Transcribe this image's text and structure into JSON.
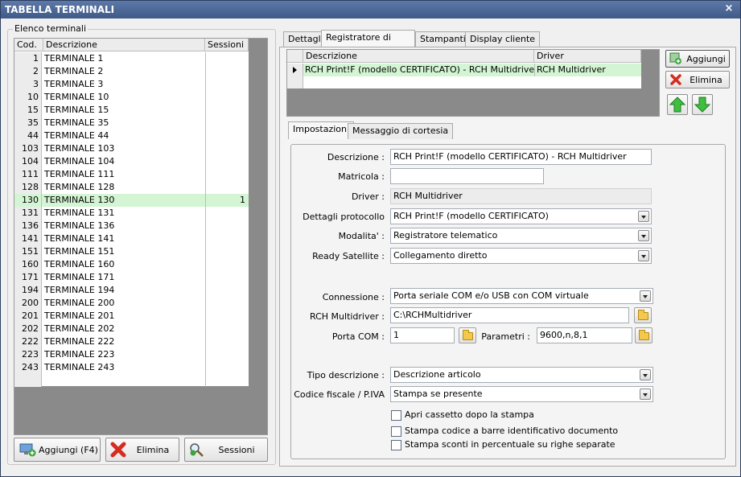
{
  "window": {
    "title": "TABELLA TERMINALI",
    "close": "×"
  },
  "left": {
    "group_title": "Elenco terminali",
    "columns": {
      "cod": "Cod.",
      "desc": "Descrizione",
      "sessions": "Sessioni"
    },
    "rows": [
      {
        "cod": "1",
        "desc": "TERMINALE 1",
        "sess": ""
      },
      {
        "cod": "2",
        "desc": "TERMINALE 2",
        "sess": ""
      },
      {
        "cod": "3",
        "desc": "TERMINALE 3",
        "sess": ""
      },
      {
        "cod": "10",
        "desc": "TERMINALE 10",
        "sess": ""
      },
      {
        "cod": "15",
        "desc": "TERMINALE 15",
        "sess": ""
      },
      {
        "cod": "35",
        "desc": "TERMINALE 35",
        "sess": ""
      },
      {
        "cod": "44",
        "desc": "TERMINALE 44",
        "sess": ""
      },
      {
        "cod": "103",
        "desc": "TERMINALE 103",
        "sess": ""
      },
      {
        "cod": "104",
        "desc": "TERMINALE 104",
        "sess": ""
      },
      {
        "cod": "111",
        "desc": "TERMINALE 111",
        "sess": ""
      },
      {
        "cod": "128",
        "desc": "TERMINALE 128",
        "sess": ""
      },
      {
        "cod": "130",
        "desc": "TERMINALE 130",
        "sess": "1"
      },
      {
        "cod": "131",
        "desc": "TERMINALE 131",
        "sess": ""
      },
      {
        "cod": "136",
        "desc": "TERMINALE 136",
        "sess": ""
      },
      {
        "cod": "141",
        "desc": "TERMINALE 141",
        "sess": ""
      },
      {
        "cod": "151",
        "desc": "TERMINALE 151",
        "sess": ""
      },
      {
        "cod": "160",
        "desc": "TERMINALE 160",
        "sess": ""
      },
      {
        "cod": "171",
        "desc": "TERMINALE 171",
        "sess": ""
      },
      {
        "cod": "194",
        "desc": "TERMINALE 194",
        "sess": ""
      },
      {
        "cod": "200",
        "desc": "TERMINALE 200",
        "sess": ""
      },
      {
        "cod": "201",
        "desc": "TERMINALE 201",
        "sess": ""
      },
      {
        "cod": "202",
        "desc": "TERMINALE 202",
        "sess": ""
      },
      {
        "cod": "222",
        "desc": "TERMINALE 222",
        "sess": ""
      },
      {
        "cod": "223",
        "desc": "TERMINALE 223",
        "sess": ""
      },
      {
        "cod": "243",
        "desc": "TERMINALE 243",
        "sess": ""
      }
    ],
    "buttons": {
      "add": "Aggiungi (F4)",
      "delete": "Elimina",
      "sessions": "Sessioni"
    }
  },
  "tabs": [
    "Dettagli",
    "Registratore di cassa",
    "Stampanti",
    "Display cliente"
  ],
  "devices": {
    "columns": {
      "desc": "Descrizione",
      "driver": "Driver"
    },
    "row": {
      "desc": "RCH Print!F (modello CERTIFICATO) - RCH Multidriver",
      "driver": "RCH Multidriver"
    },
    "add": "Aggiungi",
    "delete": "Elimina"
  },
  "subtabs": [
    "Impostazioni",
    "Messaggio di cortesia"
  ],
  "form": {
    "descrizione": {
      "label": "Descrizione :",
      "value": "RCH Print!F (modello CERTIFICATO) - RCH Multidriver"
    },
    "matricola": {
      "label": "Matricola :",
      "value": ""
    },
    "driver": {
      "label": "Driver :",
      "value": "RCH Multidriver"
    },
    "protocollo": {
      "label": "Dettagli protocollo",
      "value": "RCH Print!F (modello CERTIFICATO)"
    },
    "modalita": {
      "label": "Modalita' :",
      "value": "Registratore telematico"
    },
    "satellite": {
      "label": "Ready Satellite :",
      "value": "Collegamento diretto"
    },
    "connessione": {
      "label": "Connessione :",
      "value": "Porta seriale COM e/o USB con COM virtuale"
    },
    "multidriver": {
      "label": "RCH Multidriver :",
      "value": "C:\\RCHMultidriver"
    },
    "porta": {
      "label": "Porta COM :",
      "value": "1"
    },
    "parametri": {
      "label": "Parametri :",
      "value": "9600,n,8,1"
    },
    "tipo_desc": {
      "label": "Tipo descrizione :",
      "value": "Descrizione articolo"
    },
    "codice_fiscale": {
      "label": "Codice fiscale / P.IVA",
      "value": "Stampa se presente"
    },
    "checks": [
      "Apri cassetto dopo la stampa",
      "Stampa codice a barre identificativo documento",
      "Stampa sconti in percentuale su righe separate"
    ]
  }
}
